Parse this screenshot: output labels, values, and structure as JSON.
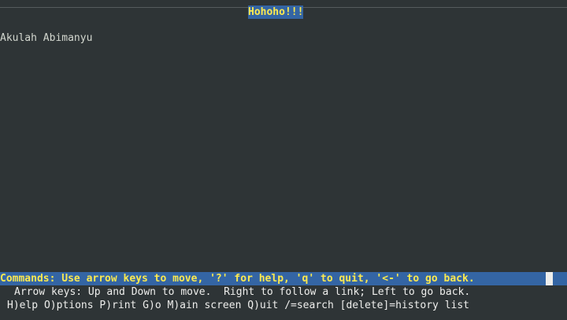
{
  "page": {
    "title": "Hohoho!!!",
    "body_text": "Akulah Abimanyu"
  },
  "statusbar": {
    "commands": "Commands: Use arrow keys to move, '?' for help, 'q' to quit, '<-' to go back."
  },
  "help": {
    "line1": "Arrow keys: Up and Down to move.  Right to follow a link; Left to go back.",
    "line2": "H)elp O)ptions P)rint G)o M)ain screen Q)uit /=search [delete]=history list"
  },
  "colors": {
    "background": "#2e3436",
    "text": "#d3d7cf",
    "highlight_bg": "#3465a4",
    "highlight_fg": "#fce94f",
    "cursor": "#eeeeec"
  }
}
